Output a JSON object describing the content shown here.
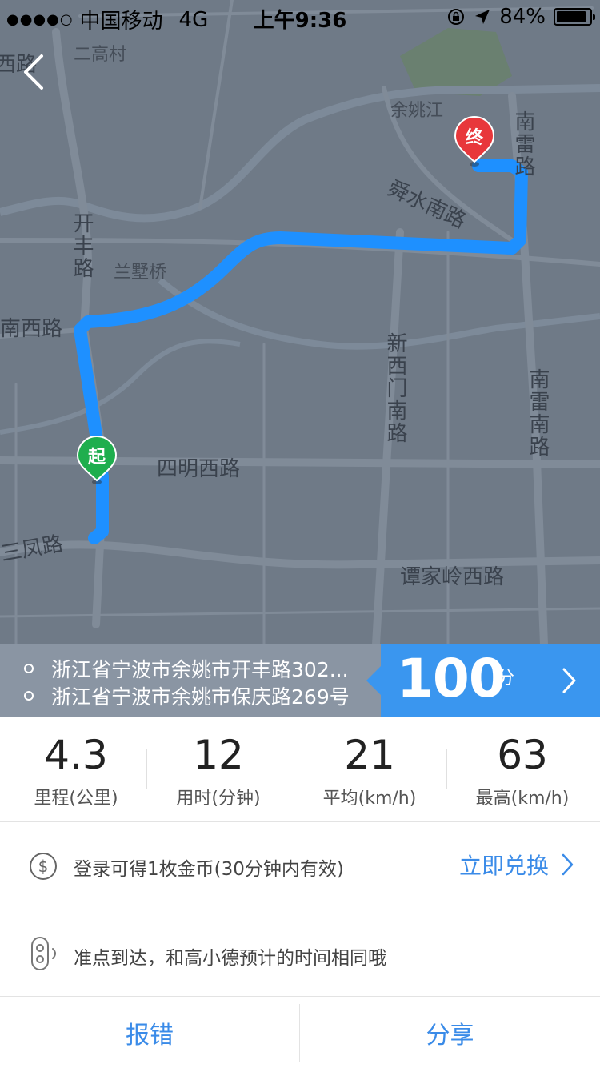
{
  "status_bar": {
    "signal": "●●●●○",
    "carrier": "中国移动",
    "network": "4G",
    "time": "上午9:36",
    "battery": "84%"
  },
  "map": {
    "labels": {
      "erjiaocun": "二高村",
      "xilu": "西路",
      "yuyaojiang": "余姚江",
      "nanlei_top": "南雷路",
      "shunshui": "舜水南路",
      "kaifeng": "开丰路",
      "lanyeqiao": "兰墅桥",
      "nanxilu": "南西路",
      "xinximen": "新西门南路",
      "nanlei_right": "南雷南路",
      "siming": "四明西路",
      "sanfeng": "三凤路",
      "tanjialing": "谭家岭西路"
    },
    "start_marker": "起",
    "end_marker": "终",
    "route_color": "#1e90ff",
    "start_color": "#1fae4e",
    "end_color": "#e8373b"
  },
  "route": {
    "from": "浙江省宁波市余姚市开丰路302...",
    "to": "浙江省宁波市余姚市保庆路269号",
    "score": "100",
    "score_unit": "分"
  },
  "stats": [
    {
      "value": "4.3",
      "label": "里程(公里)"
    },
    {
      "value": "12",
      "label": "用时(分钟)"
    },
    {
      "value": "21",
      "label": "平均(km/h)"
    },
    {
      "value": "63",
      "label": "最高(km/h)"
    }
  ],
  "coin": {
    "text": "登录可得1枚金币(30分钟内有效)",
    "action": "立即兑换"
  },
  "tip": {
    "text": "准点到达，和高小德预计的时间相同哦"
  },
  "actions": {
    "report": "报错",
    "share": "分享"
  }
}
